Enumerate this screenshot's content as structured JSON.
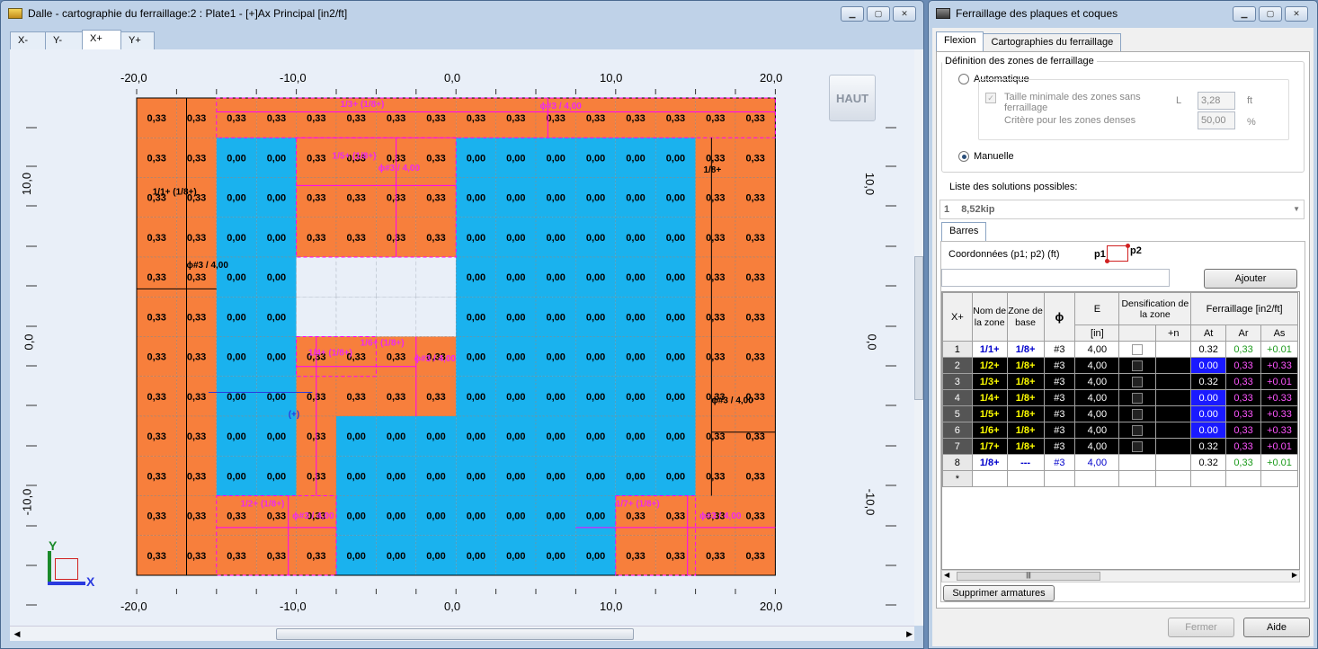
{
  "left_window": {
    "title": "Dalle - cartographie du ferraillage:2 : Plate1 - [+]Ax Principal [in2/ft]",
    "tabs": [
      "X-",
      "Y-",
      "X+",
      "Y+"
    ],
    "active_tab": "X+",
    "haut_label": "HAUT",
    "x_ticks": [
      "-20,0",
      "-10,0",
      "0,0",
      "10,0",
      "20,0"
    ],
    "y_ticks": [
      "10,0",
      "0,0",
      "-10,0"
    ],
    "axis_x": "X",
    "axis_y": "Y"
  },
  "map": {
    "colors": {
      "orange": "#f77f3c",
      "blue": "#1ab2ee",
      "hole": "#e9eff8",
      "magenta": "#ee2aee",
      "line": "#ff00ff"
    },
    "grid": [
      "OOOOOOOOOOOOOOOO",
      "OOBBOOOOBBBBBBOO",
      "OOBBOOOOBBBBBBOO",
      "OOBBOOOOBBBBBBOO",
      "OOBBHHHHBBBBBBOO",
      "OOBBHHHHBBBBBBOO",
      "OOBBOOOOBBBBBBOO",
      "OOBBOOOOBBBBBBOO",
      "OOBBOBBBBBBBBBOO",
      "OOBBOBBBBBBBBBOO",
      "OOOOOBBBBBBBOOOO",
      "OOOOOBBBBBBBOOOO"
    ],
    "orange_value": "0,33",
    "blue_value": "0,00",
    "annotations": [
      {
        "text": "1/1+ (1/8+)",
        "col": 0.4,
        "row": 2.2
      },
      {
        "text": "1/3+ (1/8+)",
        "col": 5.1,
        "row": 0.0
      },
      {
        "text": "1/5+ (1/8+)",
        "col": 4.9,
        "row": 1.3
      },
      {
        "text": "1/8+",
        "col": 14.2,
        "row": 1.65
      },
      {
        "text": "1/6+ (1/8+)",
        "col": 5.6,
        "row": 6.0
      },
      {
        "text": "1/4+ (1/8+)",
        "col": 4.3,
        "row": 6.25
      },
      {
        "text": "(+)",
        "col": 3.8,
        "row": 7.8
      },
      {
        "text": "1/2+ (1/8+)",
        "col": 2.6,
        "row": 10.05
      },
      {
        "text": "1/7+ (1/8+)",
        "col": 12.0,
        "row": 10.05
      }
    ],
    "bar_labels": [
      {
        "text": "#3 / 4,00",
        "col": 10.1,
        "row": 0.05
      },
      {
        "text": "#3 / 4,00",
        "col": 6.05,
        "row": 1.6
      },
      {
        "text": "#3 / 4,00",
        "col": 1.25,
        "row": 4.05
      },
      {
        "text": "#3 / 4,00",
        "col": 6.95,
        "row": 6.4
      },
      {
        "text": "#3 / 4,00",
        "col": 14.4,
        "row": 7.45
      },
      {
        "text": "#3 / 4,00",
        "col": 3.9,
        "row": 10.35
      },
      {
        "text": "#3 / 4,00",
        "col": 14.1,
        "row": 10.35
      }
    ]
  },
  "right_window": {
    "title": "Ferraillage des plaques et coques",
    "tabs": [
      "Flexion",
      "Cartographies du ferraillage"
    ],
    "group_title": "Définition des zones de ferraillage",
    "automatique": "Automatique",
    "taille_label": "Taille minimale des zones sans ferraillage",
    "taille_sym": "L",
    "taille_value": "3,28",
    "taille_unit": "ft",
    "critere_label": "Critère pour les zones denses",
    "critere_value": "50,00",
    "critere_unit": "%",
    "manuelle": "Manuelle",
    "solutions_label": "Liste des solutions possibles:",
    "solution_num": "1",
    "solution_value": "8,52kip",
    "barres_tab": "Barres",
    "coords_label": "Coordonnées (p1; p2) (ft)",
    "p1": "p1",
    "p2": "p2",
    "coord_value": "",
    "ajouter": "Ajouter",
    "supprimer": "Supprimer armatures",
    "fermer": "Fermer",
    "aide": "Aide"
  },
  "table": {
    "corner": "X+",
    "headers": {
      "nom": "Nom de la zone",
      "zone": "Zone de base",
      "phi": "ϕ",
      "e": "E",
      "dens": "Densification de la zone",
      "ferr": "Ferraillage [in2/ft]",
      "e_unit": "[in]",
      "n": "+n",
      "at": "At",
      "ar": "Ar",
      "as": "As"
    },
    "rows": [
      {
        "num": "1",
        "nom": "1/1+",
        "zone": "1/8+",
        "phi": "#3",
        "e": "4,00",
        "at": "0.32",
        "ar": "0,33",
        "as": "+0.01",
        "dark": false,
        "at_blue": false,
        "check": true
      },
      {
        "num": "2",
        "nom": "1/2+",
        "zone": "1/8+",
        "phi": "#3",
        "e": "4,00",
        "at": "0.00",
        "ar": "0,33",
        "as": "+0.33",
        "dark": true,
        "at_blue": true,
        "check": true
      },
      {
        "num": "3",
        "nom": "1/3+",
        "zone": "1/8+",
        "phi": "#3",
        "e": "4,00",
        "at": "0.32",
        "ar": "0,33",
        "as": "+0.01",
        "dark": true,
        "at_blue": false,
        "check": true
      },
      {
        "num": "4",
        "nom": "1/4+",
        "zone": "1/8+",
        "phi": "#3",
        "e": "4,00",
        "at": "0.00",
        "ar": "0,33",
        "as": "+0.33",
        "dark": true,
        "at_blue": true,
        "check": true
      },
      {
        "num": "5",
        "nom": "1/5+",
        "zone": "1/8+",
        "phi": "#3",
        "e": "4,00",
        "at": "0.00",
        "ar": "0,33",
        "as": "+0.33",
        "dark": true,
        "at_blue": true,
        "check": true
      },
      {
        "num": "6",
        "nom": "1/6+",
        "zone": "1/8+",
        "phi": "#3",
        "e": "4,00",
        "at": "0.00",
        "ar": "0,33",
        "as": "+0.33",
        "dark": true,
        "at_blue": true,
        "check": true
      },
      {
        "num": "7",
        "nom": "1/7+",
        "zone": "1/8+",
        "phi": "#3",
        "e": "4,00",
        "at": "0.32",
        "ar": "0,33",
        "as": "+0.01",
        "dark": true,
        "at_blue": false,
        "check": true
      },
      {
        "num": "8",
        "nom": "1/8+",
        "zone": "---",
        "phi": "#3",
        "e": "4,00",
        "at": "0.32",
        "ar": "0,33",
        "as": "+0.01",
        "dark": false,
        "at_blue": false,
        "check": false
      },
      {
        "num": "*",
        "nom": "",
        "zone": "",
        "phi": "",
        "e": "",
        "at": "",
        "ar": "",
        "as": "",
        "dark": false,
        "at_blue": false,
        "check": false
      }
    ]
  }
}
